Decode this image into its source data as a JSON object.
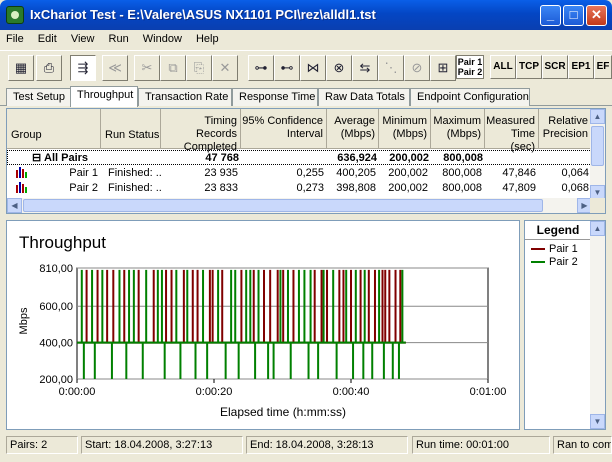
{
  "window": {
    "title": "IxChariot Test - E:\\Valere\\ASUS NX1101 PCI\\rez\\alldl1.tst",
    "minimize": "_",
    "maximize": "□",
    "close": "✕"
  },
  "menu": [
    "File",
    "Edit",
    "View",
    "Run",
    "Window",
    "Help"
  ],
  "toolbar": {
    "pair_label_1": "Pair 1",
    "pair_label_2": "Pair 2",
    "buttons_text": [
      "ALL",
      "TCP",
      "SCR",
      "EP1",
      "EF"
    ]
  },
  "tabs": [
    "Test Setup",
    "Throughput",
    "Transaction Rate",
    "Response Time",
    "Raw Data Totals",
    "Endpoint Configuration"
  ],
  "table": {
    "columns": [
      "Group",
      "Run Status",
      "Timing Records Completed",
      "95% Confidence Interval",
      "Average (Mbps)",
      "Minimum (Mbps)",
      "Maximum (Mbps)",
      "Measured Time (sec)",
      "Relative Precision"
    ],
    "group_row": {
      "expander": "⊟",
      "label": "All Pairs",
      "records": "47 768",
      "average": "636,924",
      "minimum": "200,002",
      "maximum": "800,008"
    },
    "rows": [
      {
        "pair": "Pair 1",
        "status": "Finished: ...",
        "records": "23 935",
        "ci": "0,255",
        "average": "400,205",
        "minimum": "200,002",
        "maximum": "800,008",
        "time": "47,846",
        "precision": "0,064"
      },
      {
        "pair": "Pair 2",
        "status": "Finished: ...",
        "records": "23 833",
        "ci": "0,273",
        "average": "398,808",
        "minimum": "200,002",
        "maximum": "800,008",
        "time": "47,809",
        "precision": "0,068"
      }
    ]
  },
  "chart_data": {
    "type": "line",
    "title": "Throughput",
    "xlabel": "Elapsed time (h:mm:ss)",
    "ylabel": "Mbps",
    "ylim": [
      200,
      810
    ],
    "xlim": [
      0,
      60
    ],
    "y_ticks": [
      "810,00",
      "600,00",
      "400,00",
      "200,00"
    ],
    "y_tick_values": [
      810,
      600,
      400,
      200
    ],
    "x_ticks": [
      "0:00:00",
      "0:00:20",
      "0:00:40",
      "0:01:00"
    ],
    "x_tick_values": [
      0,
      20,
      40,
      60
    ],
    "series": [
      {
        "name": "Pair 1",
        "color": "#800000",
        "base_value": 400,
        "spike_value": 800,
        "spike_times": [
          1.4,
          3.0,
          4.4,
          5.3,
          6.9,
          9.0,
          11.2,
          13.0,
          13.8,
          15.6,
          16.9,
          17.6,
          19.4,
          19.8,
          21.2,
          24.0,
          25.8,
          27.3,
          28.2,
          29.3,
          30.1,
          31.6,
          34.7,
          35.7,
          36.5,
          38.3,
          38.9,
          40.0,
          41.4,
          42.6,
          43.5,
          44.6,
          45.0,
          45.6,
          46.5,
          47.2
        ]
      },
      {
        "name": "Pair 2",
        "color": "#008000",
        "base_value": 400,
        "spike_value": 800,
        "dip_value": 200,
        "spike_times": [
          0.7,
          2.2,
          3.7,
          6.2,
          7.6,
          8.3,
          10.1,
          11.8,
          12.4,
          14.5,
          16.1,
          18.4,
          20.6,
          22.5,
          23.1,
          24.7,
          25.3,
          26.5,
          29.7,
          30.8,
          32.4,
          33.2,
          34.1,
          36.0,
          37.4,
          39.3,
          40.7,
          42.0,
          44.1,
          47.5
        ],
        "dip_times": [
          1.0,
          2.6,
          5.1,
          7.2,
          9.6,
          12.8,
          15.1,
          17.3,
          19.0,
          21.7,
          23.6,
          26.0,
          27.9,
          28.7,
          31.2,
          33.8,
          35.2,
          37.9,
          40.3,
          41.8,
          43.1,
          44.8,
          46.1,
          47.0
        ]
      }
    ]
  },
  "legend": {
    "title": "Legend",
    "items": [
      "Pair 1",
      "Pair 2"
    ]
  },
  "status": {
    "pairs": "Pairs: 2",
    "start": "Start: 18.04.2008, 3:27:13",
    "end": "End: 18.04.2008, 3:28:13",
    "run_time": "Run time: 00:01:00",
    "result": "Ran to com"
  }
}
